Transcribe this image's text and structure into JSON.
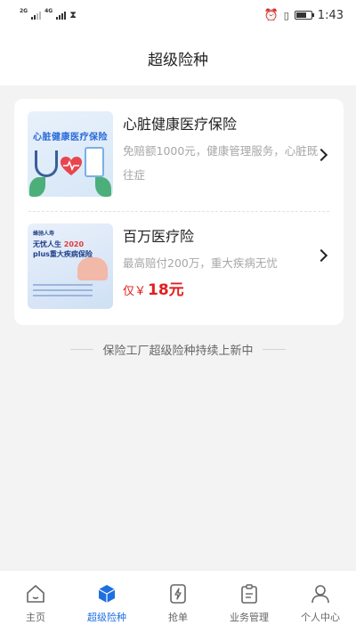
{
  "status_bar": {
    "net1": "2G",
    "net2": "4G",
    "time": "1:43"
  },
  "header": {
    "title": "超级险种"
  },
  "products": [
    {
      "name": "心脏健康医疗保险",
      "description": "免赔额1000元，健康管理服务，心脏既往症",
      "thumb_text": "心脏健康医疗保险"
    },
    {
      "name": "百万医疗险",
      "description": "最高赔付200万，重大疾病无忧",
      "price_prefix": "仅￥",
      "price": "18元",
      "thumb_logo": "蜂驰人寿",
      "thumb_line1": "无忧人生",
      "thumb_year": "2020",
      "thumb_line2": "plus重大疾病保险"
    }
  ],
  "footer_note": "保险工厂超级险种持续上新中",
  "tabs": [
    {
      "label": "主页",
      "icon": "home-icon",
      "active": false
    },
    {
      "label": "超级险种",
      "icon": "cube-icon",
      "active": true
    },
    {
      "label": "抢单",
      "icon": "lightning-icon",
      "active": false
    },
    {
      "label": "业务管理",
      "icon": "clipboard-icon",
      "active": false
    },
    {
      "label": "个人中心",
      "icon": "user-icon",
      "active": false
    }
  ],
  "colors": {
    "accent": "#1f6fe0",
    "price": "#e02020",
    "background": "#f3f3f3"
  }
}
